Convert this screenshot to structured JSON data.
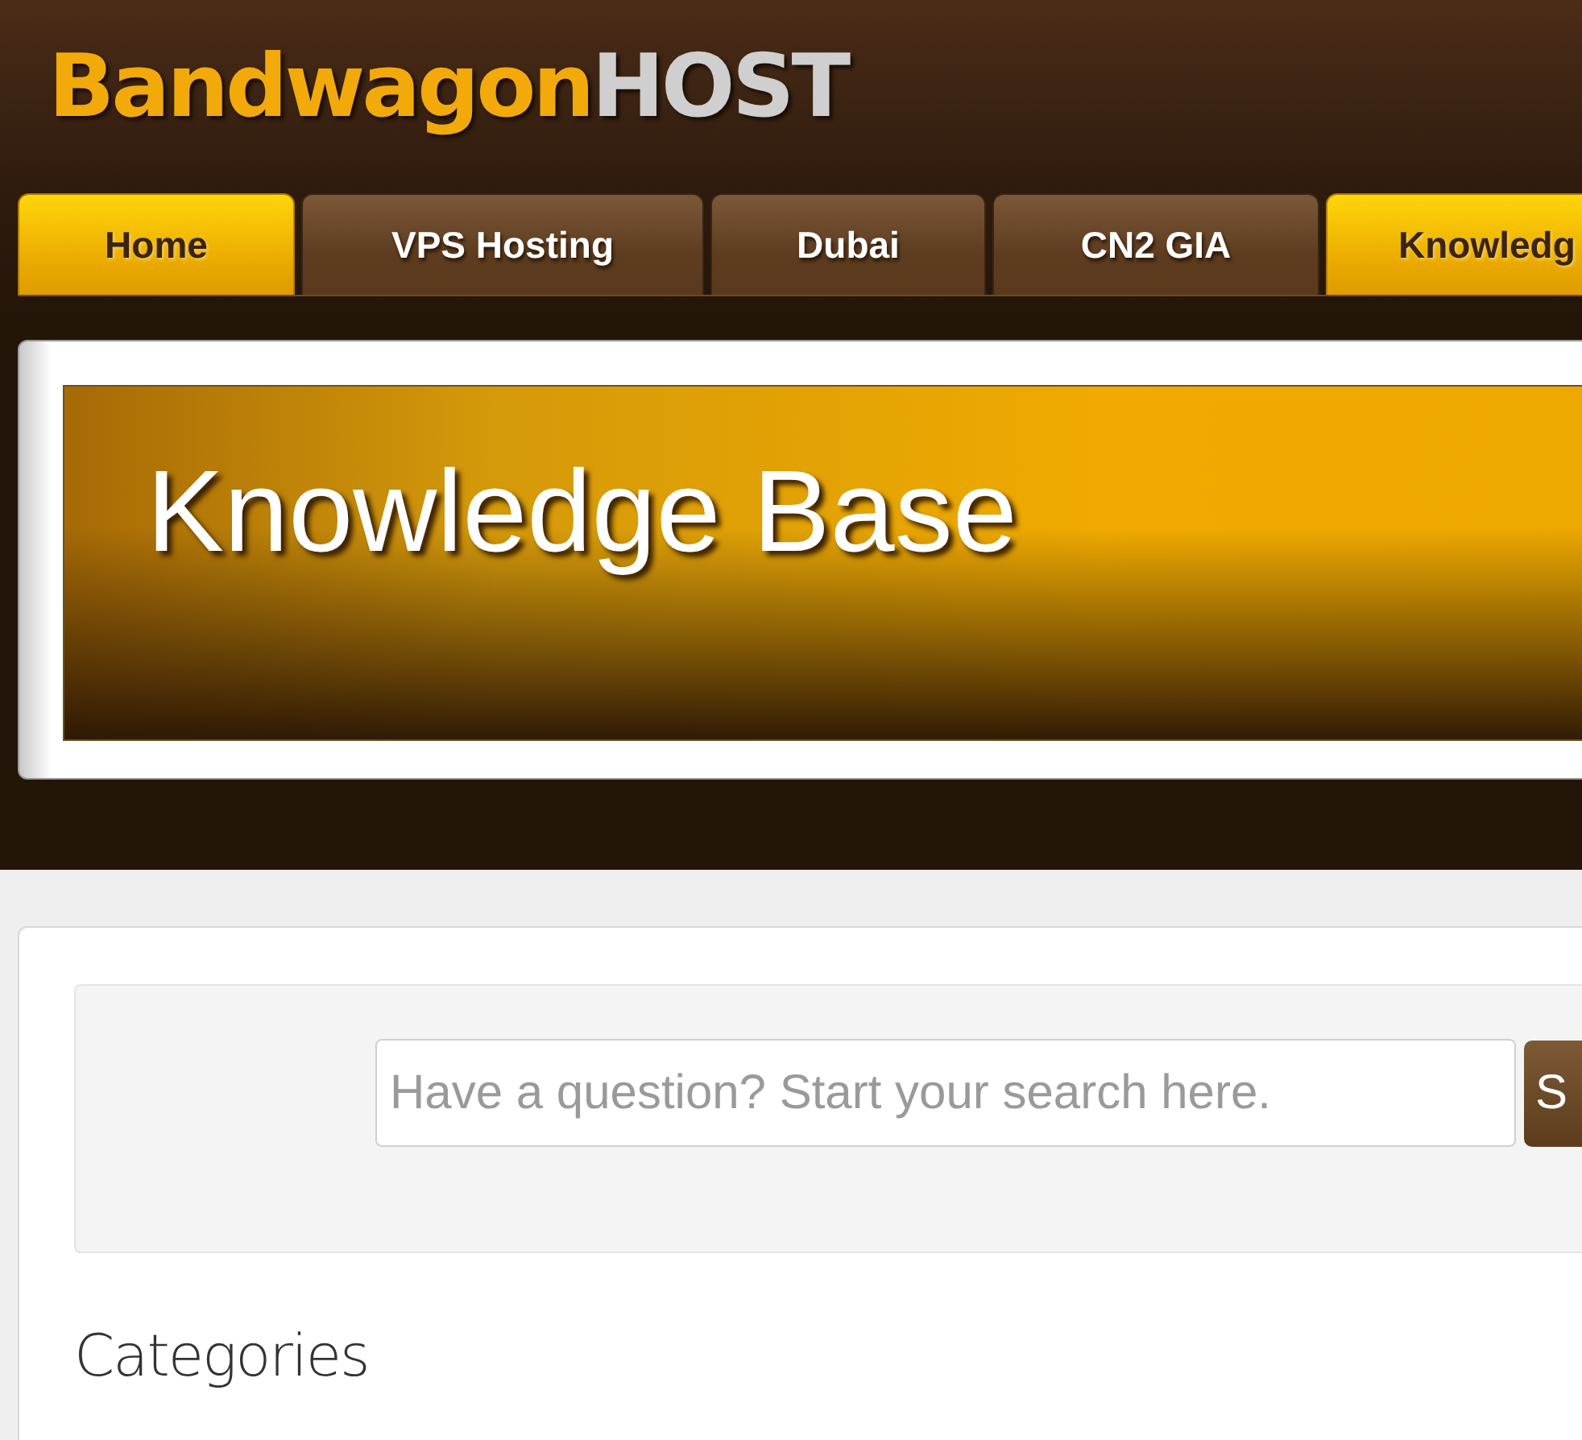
{
  "logo": {
    "brand": "Bandwagon",
    "accent": "HOST"
  },
  "tabs": [
    {
      "label": "Home",
      "selected": true
    },
    {
      "label": "VPS Hosting",
      "selected": false
    },
    {
      "label": "Dubai",
      "selected": false
    },
    {
      "label": "CN2 GIA",
      "selected": false
    },
    {
      "label": "Knowledg",
      "selected": true
    }
  ],
  "banner": {
    "title": "Knowledge Base"
  },
  "search": {
    "placeholder": "Have a question? Start your search here.",
    "button": "S"
  },
  "section": {
    "title": "Categories"
  }
}
